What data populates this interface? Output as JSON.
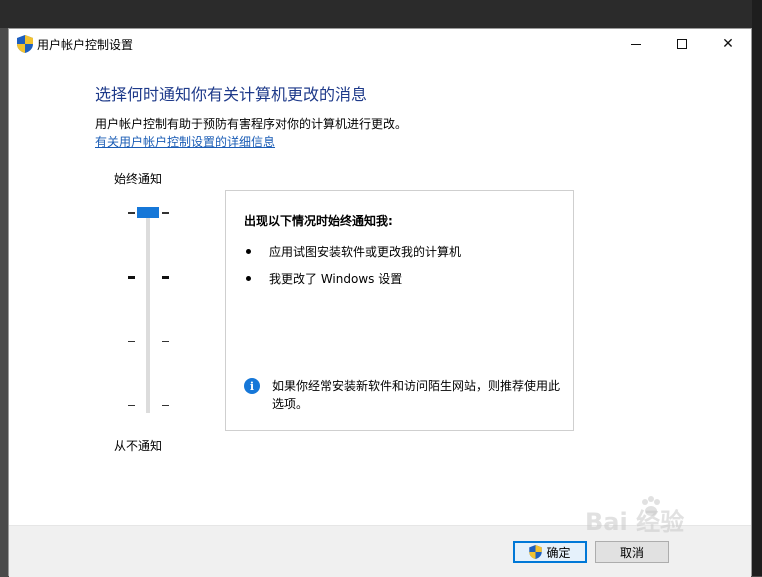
{
  "window": {
    "title": "用户帐户控制设置",
    "buttons": {
      "minimize": "minimize",
      "maximize": "maximize",
      "close": "✕"
    }
  },
  "main": {
    "heading": "选择何时通知你有关计算机更改的消息",
    "description": "用户帐户控制有助于预防有害程序对你的计算机进行更改。",
    "link": "有关用户帐户控制设置的详细信息"
  },
  "slider": {
    "top_label": "始终通知",
    "bottom_label": "从不通知",
    "levels": 4,
    "selected_level": 4
  },
  "info": {
    "title": "出现以下情况时始终通知我:",
    "bullets": [
      "应用试图安装软件或更改我的计算机",
      "我更改了 Windows 设置"
    ],
    "recommendation": "如果你经常安装新软件和访问陌生网站，则推荐使用此选项。"
  },
  "footer": {
    "ok": "确定",
    "cancel": "取消"
  },
  "watermark": {
    "text": "Bai 经验"
  },
  "icons": {
    "title": "shield-icon",
    "ok": "shield-icon",
    "info": "info-icon"
  },
  "colors": {
    "heading": "#1e3a8a",
    "link": "#1a5cb5",
    "accent": "#1677d8"
  }
}
